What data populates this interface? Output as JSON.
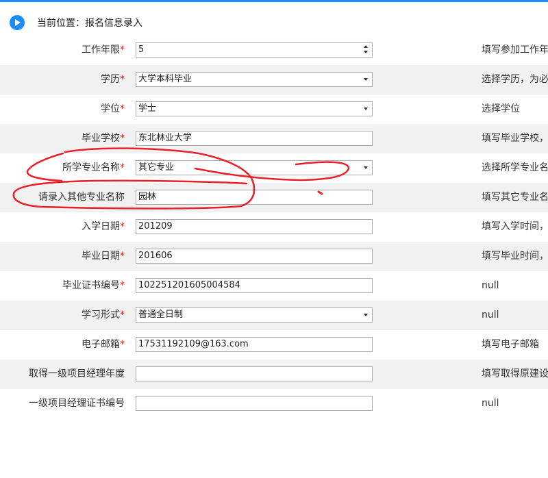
{
  "breadcrumb": {
    "text": "当前位置：报名信息录入",
    "icon": "play-circle-icon",
    "accent": "#1a8cff"
  },
  "required_mark": "*",
  "rows": [
    {
      "label": "工作年限",
      "required": true,
      "value": "5",
      "control": "spinner",
      "hint": "填写参加工作年"
    },
    {
      "label": "学历",
      "required": true,
      "value": "大学本科毕业",
      "control": "select",
      "hint": "选择学历，为必"
    },
    {
      "label": "学位",
      "required": true,
      "value": "学士",
      "control": "select",
      "hint": "选择学位"
    },
    {
      "label": "毕业学校",
      "required": true,
      "value": "东北林业大学",
      "control": "text",
      "hint": "填写毕业学校，"
    },
    {
      "label": "所学专业名称",
      "required": true,
      "value": "其它专业",
      "control": "select",
      "hint": "选择所学专业名"
    },
    {
      "label": "请录入其他专业名称",
      "required": false,
      "value": "园林",
      "control": "text",
      "hint": "填写其它专业名"
    },
    {
      "label": "入学日期",
      "required": true,
      "value": "201209",
      "control": "text",
      "hint": "填写入学时间，"
    },
    {
      "label": "毕业日期",
      "required": true,
      "value": "201606",
      "control": "text",
      "hint": "填写毕业时间，"
    },
    {
      "label": "毕业证书编号",
      "required": true,
      "value": "102251201605004584",
      "control": "text",
      "hint": "null"
    },
    {
      "label": "学习形式",
      "required": true,
      "value": "普通全日制",
      "control": "select",
      "hint": "null"
    },
    {
      "label": "电子邮箱",
      "required": true,
      "value": "17531192109@163.com",
      "control": "text",
      "hint": "填写电子邮箱"
    },
    {
      "label": "取得一级项目经理年度",
      "required": false,
      "value": "",
      "control": "text",
      "hint": "填写取得原建设"
    },
    {
      "label": "一级项目经理证书编号",
      "required": false,
      "value": "",
      "control": "text",
      "hint": "null"
    }
  ],
  "colors": {
    "required": "#e02020",
    "annotation": "#e8202a",
    "row_alt": "#f1f1f1"
  }
}
